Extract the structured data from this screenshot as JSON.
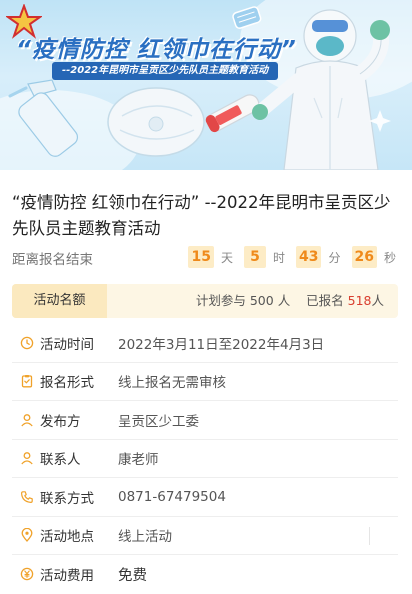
{
  "banner": {
    "title": "“疫情防控 红领巾在行动”",
    "subtitle": "--2022年昆明市呈贡区少先队员主题教育活动"
  },
  "event": {
    "title": "“疫情防控 红领巾在行动” --2022年昆明市呈贡区少先队员主题教育活动"
  },
  "countdown": {
    "label": "距离报名结束",
    "days": "15",
    "days_unit": "天",
    "hours": "5",
    "hours_unit": "时",
    "minutes": "43",
    "minutes_unit": "分",
    "seconds": "26",
    "seconds_unit": "秒"
  },
  "quota": {
    "tab_label": "活动名额",
    "plan_prefix": "计划参与",
    "plan_count": "500",
    "plan_unit": "人",
    "signed_prefix": "已报名",
    "signed_count": "518",
    "signed_unit": "人"
  },
  "info": {
    "time": {
      "label": "活动时间",
      "value": "2022年3月11日至2022年4月3日"
    },
    "form": {
      "label": "报名形式",
      "value": "线上报名无需审核"
    },
    "publisher": {
      "label": "发布方",
      "value": "呈贡区少工委"
    },
    "contact": {
      "label": "联系人",
      "value": "康老师"
    },
    "phone": {
      "label": "联系方式",
      "value": "0871-67479504"
    },
    "location": {
      "label": "活动地点",
      "value": "线上活动"
    },
    "fee": {
      "label": "活动费用",
      "value": "免费"
    }
  },
  "colors": {
    "accent_orange": "#f0a22a",
    "countdown_text": "#ef8a1b",
    "countdown_bg": "#fdecc6",
    "highlight_red": "#d93f2f",
    "banner_blue": "#2a6fc2"
  }
}
